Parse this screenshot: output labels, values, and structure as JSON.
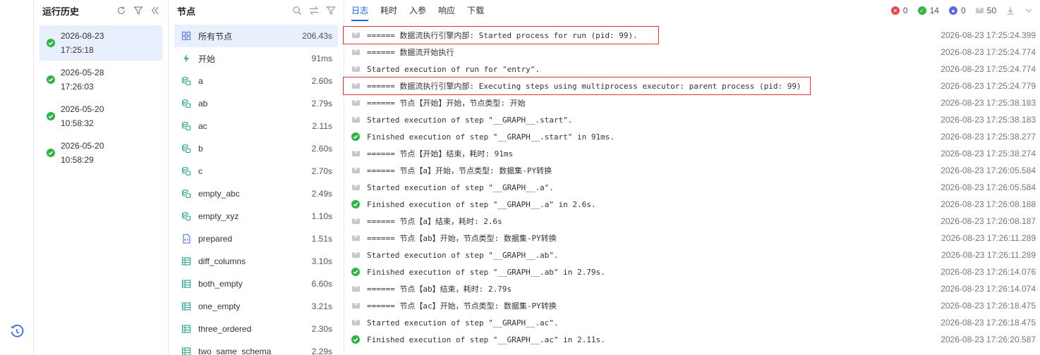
{
  "history": {
    "title": "运行历史",
    "runs": [
      {
        "date": "2026-08-23",
        "time": "17:25:18"
      },
      {
        "date": "2026-05-28",
        "time": "17:26:03"
      },
      {
        "date": "2026-05-20",
        "time": "10:58:32"
      },
      {
        "date": "2026-05-20",
        "time": "10:58:29"
      }
    ]
  },
  "nodes": {
    "title": "节点",
    "items": [
      {
        "name": "所有节点",
        "time": "206.43s",
        "icon": "grid-icon"
      },
      {
        "name": "开始",
        "time": "91ms",
        "icon": "lightning-icon"
      },
      {
        "name": "a",
        "time": "2.60s",
        "icon": "dataset-py-icon"
      },
      {
        "name": "ab",
        "time": "2.79s",
        "icon": "dataset-py-icon"
      },
      {
        "name": "ac",
        "time": "2.11s",
        "icon": "dataset-py-icon"
      },
      {
        "name": "b",
        "time": "2.60s",
        "icon": "dataset-py-icon"
      },
      {
        "name": "c",
        "time": "2.70s",
        "icon": "dataset-py-icon"
      },
      {
        "name": "empty_abc",
        "time": "2.49s",
        "icon": "dataset-py-icon"
      },
      {
        "name": "empty_xyz",
        "time": "1.10s",
        "icon": "dataset-py-icon"
      },
      {
        "name": "prepared",
        "time": "1.51s",
        "icon": "code-file-icon"
      },
      {
        "name": "diff_columns",
        "time": "3.10s",
        "icon": "table-icon"
      },
      {
        "name": "both_empty",
        "time": "6.60s",
        "icon": "table-icon"
      },
      {
        "name": "one_empty",
        "time": "3.21s",
        "icon": "table-icon"
      },
      {
        "name": "three_ordered",
        "time": "2.30s",
        "icon": "table-icon"
      },
      {
        "name": "two_same_schema",
        "time": "2.29s",
        "icon": "table-icon"
      }
    ]
  },
  "tabs": [
    "日志",
    "耗时",
    "入参",
    "响应",
    "下载"
  ],
  "stats": {
    "error": "0",
    "success": "14",
    "user": "0",
    "messages": "50"
  },
  "colors": {
    "accent": "#1a66e0",
    "success": "#2fb344",
    "error": "#e5484d",
    "user": "#5b6bd6",
    "highlight": "#d9363e"
  },
  "logs": [
    {
      "type": "info",
      "msg": "====== 数据流执行引擎内部: Started process for run (pid: 99).",
      "ts": "2026-08-23 17:25:24.399"
    },
    {
      "type": "info",
      "msg": "====== 数据流开始执行",
      "ts": "2026-08-23 17:25:24.774"
    },
    {
      "type": "info",
      "msg": "Started execution of run for \"entry\".",
      "ts": "2026-08-23 17:25:24.774"
    },
    {
      "type": "info",
      "msg": "====== 数据流执行引擎内部: Executing steps using multiprocess executor: parent process (pid: 99)",
      "ts": "2026-08-23 17:25:24.779"
    },
    {
      "type": "info",
      "msg": "====== 节点【开始】开始，节点类型: 开始",
      "ts": "2026-08-23 17:25:38.183"
    },
    {
      "type": "info",
      "msg": "Started execution of step \"__GRAPH__.start\".",
      "ts": "2026-08-23 17:25:38.183"
    },
    {
      "type": "ok",
      "msg": "Finished execution of step \"__GRAPH__.start\" in 91ms.",
      "ts": "2026-08-23 17:25:38.277"
    },
    {
      "type": "info",
      "msg": "====== 节点【开始】结束，耗时: 91ms",
      "ts": "2026-08-23 17:25:38.274"
    },
    {
      "type": "info",
      "msg": "====== 节点【a】开始，节点类型: 数据集-PY转换",
      "ts": "2026-08-23 17:26:05.584"
    },
    {
      "type": "info",
      "msg": "Started execution of step \"__GRAPH__.a\".",
      "ts": "2026-08-23 17:26:05.584"
    },
    {
      "type": "ok",
      "msg": "Finished execution of step \"__GRAPH__.a\" in 2.6s.",
      "ts": "2026-08-23 17:26:08.188"
    },
    {
      "type": "info",
      "msg": "====== 节点【a】结束，耗时: 2.6s",
      "ts": "2026-08-23 17:26:08.187"
    },
    {
      "type": "info",
      "msg": "====== 节点【ab】开始，节点类型: 数据集-PY转换",
      "ts": "2026-08-23 17:26:11.289"
    },
    {
      "type": "info",
      "msg": "Started execution of step \"__GRAPH__.ab\".",
      "ts": "2026-08-23 17:26:11.289"
    },
    {
      "type": "ok",
      "msg": "Finished execution of step \"__GRAPH__.ab\" in 2.79s.",
      "ts": "2026-08-23 17:26:14.076"
    },
    {
      "type": "info",
      "msg": "====== 节点【ab】结束，耗时: 2.79s",
      "ts": "2026-08-23 17:26:14.074"
    },
    {
      "type": "info",
      "msg": "====== 节点【ac】开始，节点类型: 数据集-PY转换",
      "ts": "2026-08-23 17:26:18.475"
    },
    {
      "type": "info",
      "msg": "Started execution of step \"__GRAPH__.ac\".",
      "ts": "2026-08-23 17:26:18.475"
    },
    {
      "type": "ok",
      "msg": "Finished execution of step \"__GRAPH__.ac\" in 2.11s.",
      "ts": "2026-08-23 17:26:20.587"
    }
  ]
}
